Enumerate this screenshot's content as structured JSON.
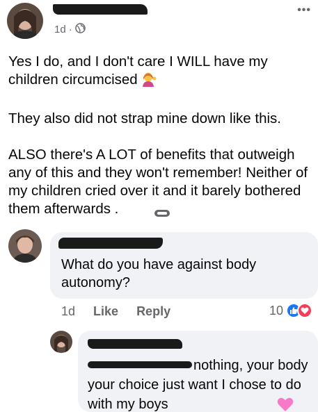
{
  "post": {
    "time": "1d",
    "separator": "·",
    "paragraph_1": "Yes I do, and I don't care I WILL have my children  circumcised",
    "paragraph_2": "They also did not strap mine down like this.",
    "paragraph_3": "ALSO there's A LOT of benefits that outweigh any of this and they won't remember! Neither of my children cried over it and it barely bothered them afterwards .",
    "inline_emoji": "person-tipping-hand-icon"
  },
  "comment_1": {
    "text": "What do you have against body autonomy?",
    "time": "1d",
    "like_label": "Like",
    "reply_label": "Reply",
    "reaction_count": "10"
  },
  "reply_1": {
    "text": "nothing, your body your choice just want I chose to do with my boys",
    "trailing_emoji": "pink-heart-icon"
  },
  "colors": {
    "bubble": "#f0f2f5",
    "meta_text": "#65676b",
    "like_blue": "#1877f2",
    "love_red": "#f33e58",
    "redaction": "#1a1a1a"
  }
}
